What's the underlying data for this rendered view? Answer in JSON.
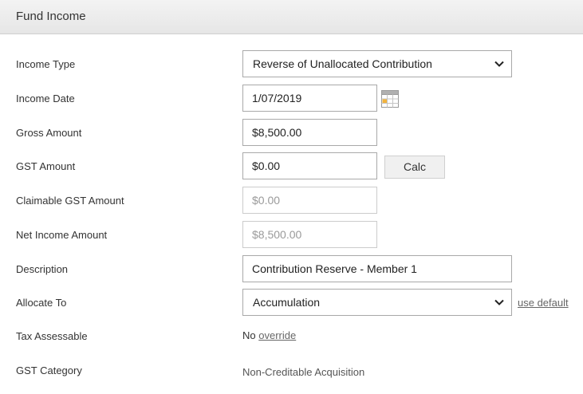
{
  "header": {
    "title": "Fund Income"
  },
  "form": {
    "income_type": {
      "label": "Income Type",
      "value": "Reverse of Unallocated Contribution"
    },
    "income_date": {
      "label": "Income Date",
      "value": "1/07/2019"
    },
    "gross_amount": {
      "label": "Gross Amount",
      "value": "$8,500.00"
    },
    "gst_amount": {
      "label": "GST Amount",
      "value": "$0.00",
      "calc_label": "Calc"
    },
    "claimable_gst": {
      "label": "Claimable GST Amount",
      "value": "$0.00"
    },
    "net_income": {
      "label": "Net Income Amount",
      "value": "$8,500.00"
    },
    "description": {
      "label": "Description",
      "value": "Contribution Reserve - Member 1"
    },
    "allocate_to": {
      "label": "Allocate To",
      "value": "Accumulation",
      "link": "use default"
    },
    "tax_assessable": {
      "label": "Tax Assessable",
      "value": "No",
      "link": "override"
    },
    "gst_category": {
      "label": "GST Category",
      "value": "Non-Creditable Acquisition"
    }
  },
  "icons": {
    "calendar": "calendar-icon",
    "dropdown": "chevron-down-icon"
  }
}
